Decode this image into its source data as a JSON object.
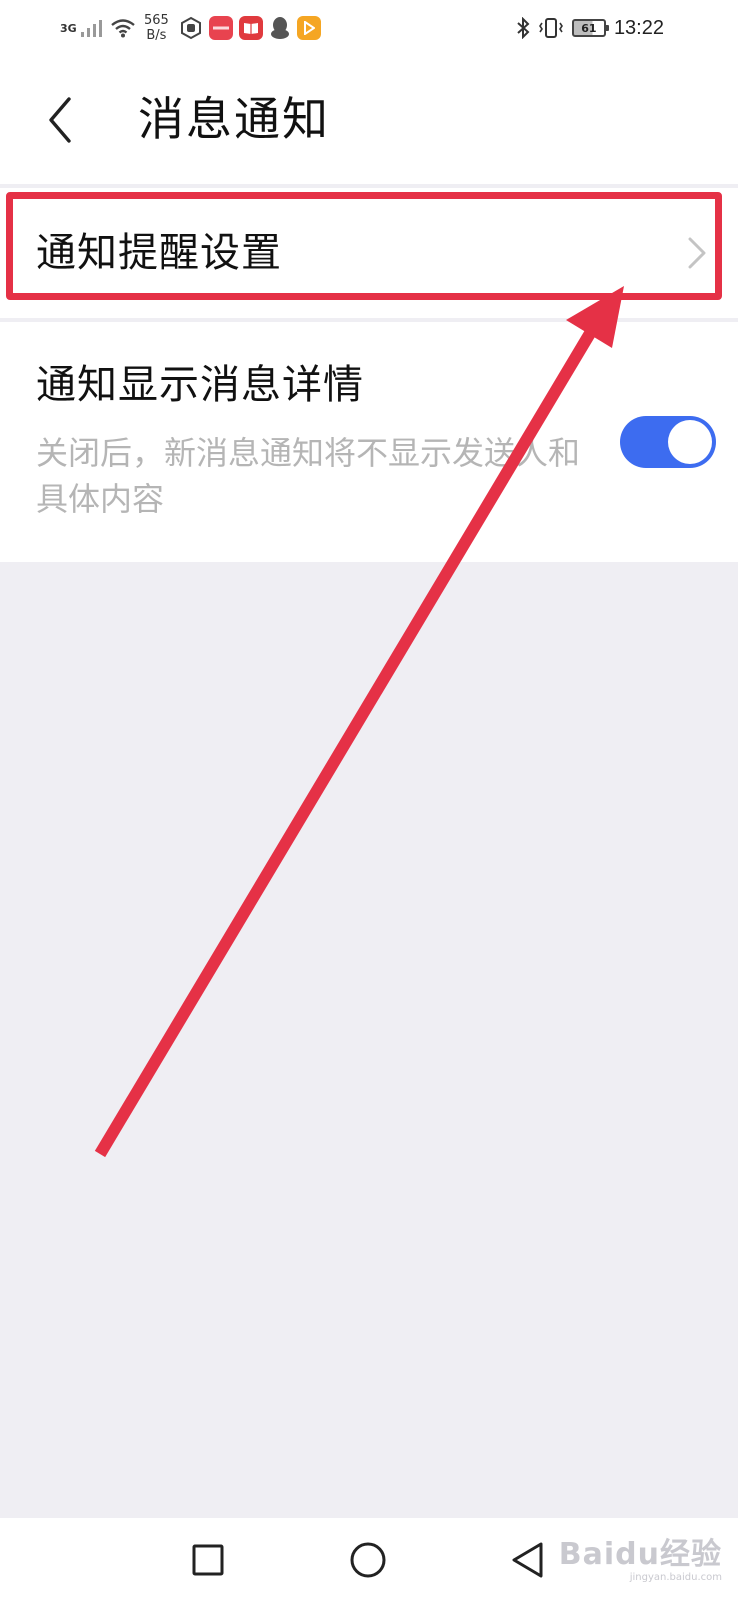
{
  "status_bar": {
    "network_type": "3G",
    "net_speed_value": "565",
    "net_speed_unit": "B/s",
    "battery_level": "61",
    "time": "13:22",
    "icons": [
      "signal-icon",
      "wifi-icon",
      "hand-icon",
      "huawei-app-icon",
      "book-app-icon",
      "qq-icon",
      "video-app-icon",
      "bluetooth-icon",
      "vibrate-icon",
      "battery-icon"
    ]
  },
  "header": {
    "title": "消息通知",
    "back_icon": "chevron-left-icon"
  },
  "settings": {
    "reminder": {
      "label": "通知提醒设置",
      "icon": "chevron-right-icon"
    },
    "details": {
      "label": "通知显示消息详情",
      "description": "关闭后，新消息通知将不显示发送人和具体内容",
      "toggle_on": true
    }
  },
  "annotation": {
    "color": "#e53146"
  },
  "nav_bar": {
    "icons": [
      "recent-apps-icon",
      "home-icon",
      "back-icon"
    ]
  },
  "watermark": {
    "main": "Baidu经验",
    "sub": "jingyan.baidu.com"
  },
  "colors": {
    "accent": "#3d6cf0",
    "background": "#efeef3",
    "surface": "#ffffff"
  }
}
